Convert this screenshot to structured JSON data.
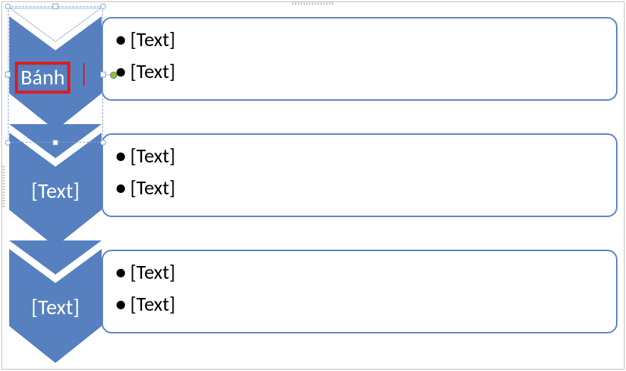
{
  "rows": [
    {
      "chevron_label": "Bánh",
      "selected": true,
      "bullets": [
        "[Text]",
        "[Text]"
      ]
    },
    {
      "chevron_label": "[Text]",
      "selected": false,
      "bullets": [
        "[Text]",
        "[Text]"
      ]
    },
    {
      "chevron_label": "[Text]",
      "selected": false,
      "bullets": [
        "[Text]",
        "[Text]"
      ]
    }
  ],
  "colors": {
    "shape_fill": "#5780c0",
    "shape_stroke": "#4c7abf",
    "selection_red": "#e11b1b"
  }
}
